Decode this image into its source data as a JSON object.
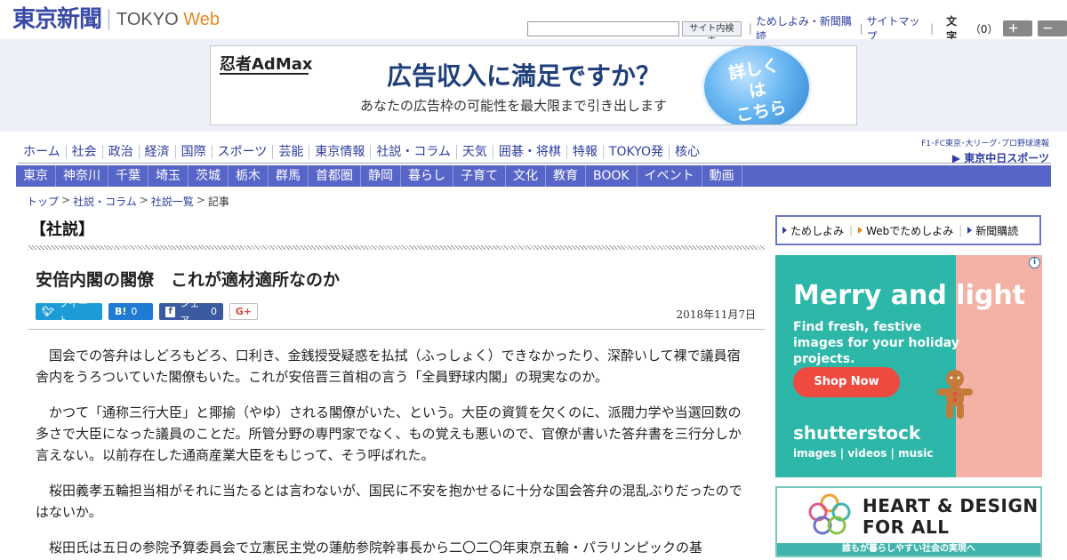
{
  "header": {
    "logo_jp": "東京新聞",
    "logo_en_1": "TOKYO ",
    "logo_en_2": "Web",
    "search_button": "サイト内検索",
    "links": [
      "ためしよみ・新聞購読",
      "サイトマップ"
    ],
    "font_label": "文字",
    "font_count": "（0）",
    "font_up": "＋大",
    "font_down": "－小"
  },
  "top_ad": {
    "brand": "忍者AdMax",
    "headline": "広告収入に満足ですか？",
    "sub": "あなたの広告枠の可能性を最大限まで引き出します",
    "cta_1": "詳しくは",
    "cta_2": "こちら"
  },
  "nav_primary": [
    "ホーム",
    "社会",
    "政治",
    "経済",
    "国際",
    "スポーツ",
    "芸能",
    "東京情報",
    "社説・コラム",
    "天気",
    "囲碁・将棋",
    "特報",
    "TOKYO発",
    "核心"
  ],
  "nav_secondary": [
    "東京",
    "神奈川",
    "千葉",
    "埼玉",
    "茨城",
    "栃木",
    "群馬",
    "首都圏",
    "静岡",
    "暮らし",
    "子育て",
    "文化",
    "教育",
    "BOOK",
    "イベント",
    "動画"
  ],
  "sponsor": {
    "top": "F1･FC東京･大リーグ･プロ野球速報",
    "bottom": "▶ 東京中日スポーツ"
  },
  "breadcrumb": [
    "トップ",
    "社説・コラム",
    "社説一覧",
    "記事"
  ],
  "article": {
    "section": "【社説】",
    "headline": "安倍内閣の閣僚　これが適材適所なのか",
    "date": "2018年11月7日",
    "share": {
      "tweet": "ツイート",
      "hatena": "B!",
      "hatena_count": "0",
      "fb": "シェア",
      "fb_count": "0",
      "gplus": "G+"
    },
    "paragraphs": [
      "国会での答弁はしどろもどろ、口利き、金銭授受疑惑を払拭（ふっしょく）できなかったり、深酔いして裸で議員宿舎内をうろついていた閣僚もいた。これが安倍晋三首相の言う「全員野球内閣」の現実なのか。",
      "かつて「通称三行大臣」と揶揄（やゆ）される閣僚がいた、という。大臣の資質を欠くのに、派閥力学や当選回数の多さで大臣になった議員のことだ。所管分野の専門家でなく、もの覚えも悪いので、官僚が書いた答弁書を三行分しか言えない。以前存在した通商産業大臣をもじって、そう呼ばれた。",
      "桜田義孝五輪担当相がそれに当たるとは言わないが、国民に不安を抱かせるに十分な国会答弁の混乱ぶりだったのではないか。",
      "桜田氏は五日の参院予算委員会で立憲民主党の蓮舫参院幹事長から二〇二〇年東京五輪・パラリンピックの基"
    ]
  },
  "promo": [
    "ためしよみ",
    "Webでためしよみ",
    "新聞購読"
  ],
  "ad_side": {
    "title": "Merry and light",
    "sub": "Find fresh, festive images for your holiday projects.",
    "button": "Shop Now",
    "brand": "shutterstock",
    "links": "images  |  videos  |  music",
    "info": "i"
  },
  "ad_bottom": {
    "line1": "HEART & DESIGN",
    "line2": "FOR ALL",
    "band": "誰もが暮らしやすい社会の実現へ"
  },
  "colors": {
    "brand_blue": "#3a4aa6",
    "nav_bar": "#5865c8",
    "accent_orange": "#e8871e"
  }
}
